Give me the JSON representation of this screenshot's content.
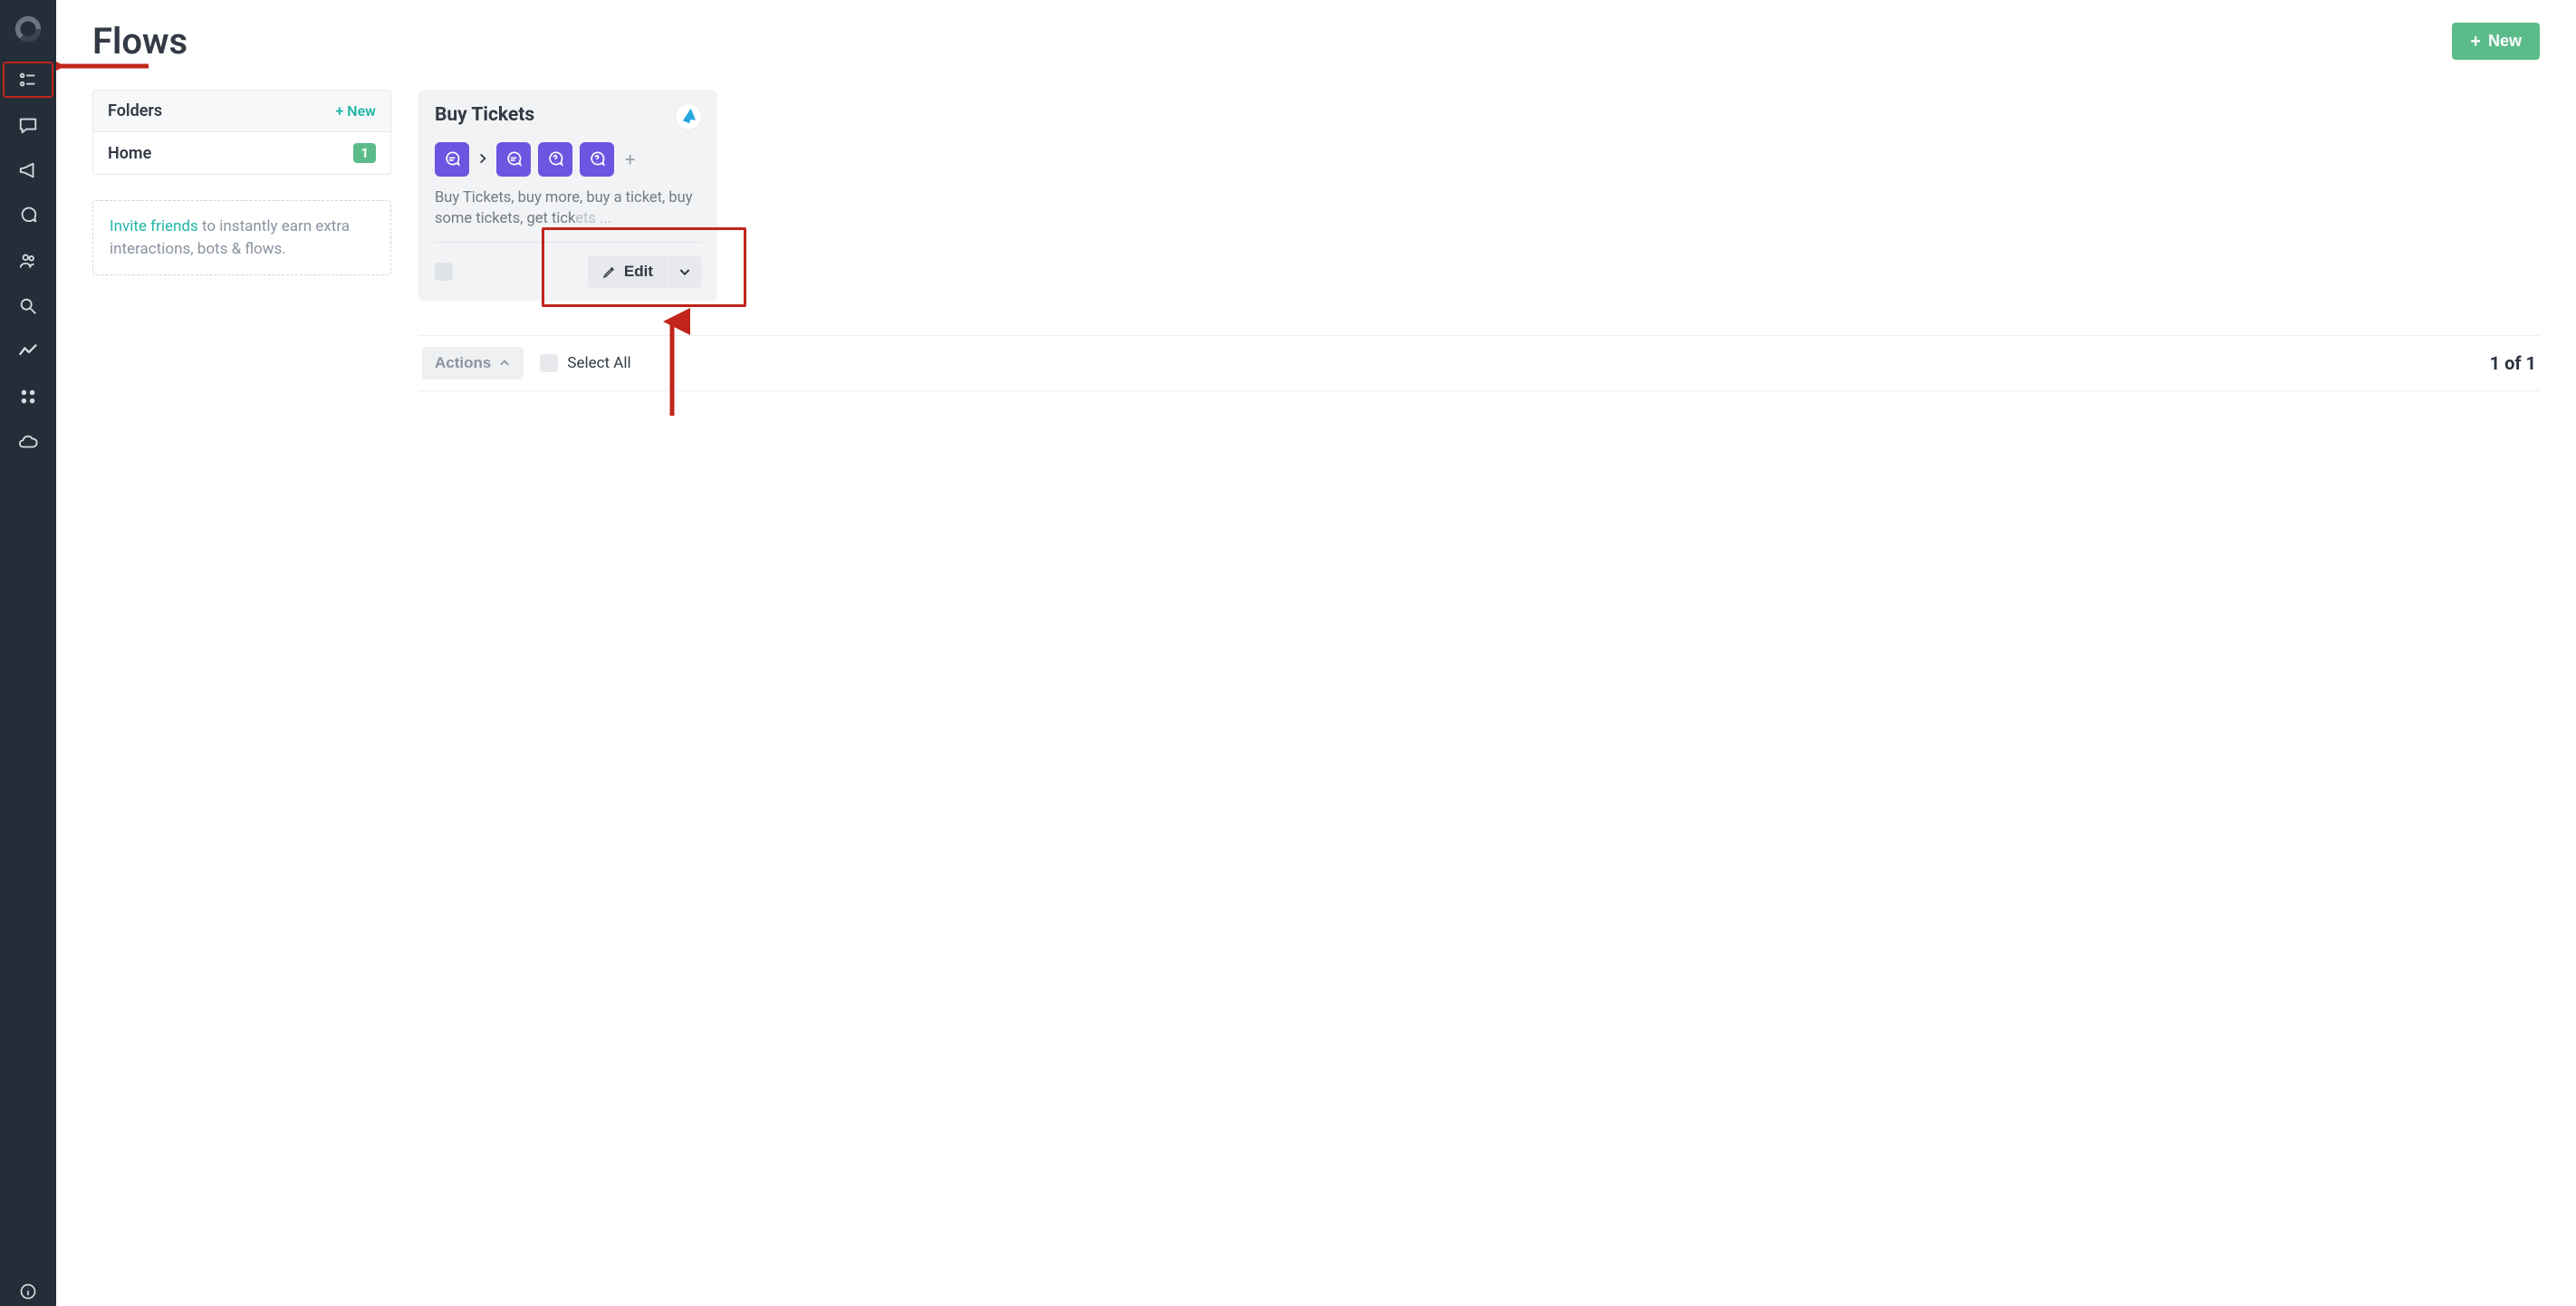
{
  "page": {
    "title": "Flows",
    "new_button": "New",
    "page_count": "1 of 1"
  },
  "nav": {
    "items": [
      {
        "name": "flows",
        "active": true
      },
      {
        "name": "chat",
        "active": false
      },
      {
        "name": "megaphone",
        "active": false
      },
      {
        "name": "conversation",
        "active": false
      },
      {
        "name": "users",
        "active": false
      },
      {
        "name": "search",
        "active": false
      },
      {
        "name": "analytics",
        "active": false
      },
      {
        "name": "apps",
        "active": false
      },
      {
        "name": "cloud",
        "active": false
      }
    ]
  },
  "folders": {
    "header": "Folders",
    "new_label": "New",
    "rows": [
      {
        "name": "Home",
        "count": "1"
      }
    ]
  },
  "invite": {
    "link_text": "Invite friends",
    "rest": " to instantly earn extra interactions, bots & flows."
  },
  "flow_card": {
    "title": "Buy Tickets",
    "description_main": "Buy Tickets, buy more, buy a ticket, buy some tickets, get tick",
    "description_fade": "ets ...",
    "edit_label": "Edit"
  },
  "actions_bar": {
    "actions_label": "Actions",
    "select_all_label": "Select All"
  }
}
